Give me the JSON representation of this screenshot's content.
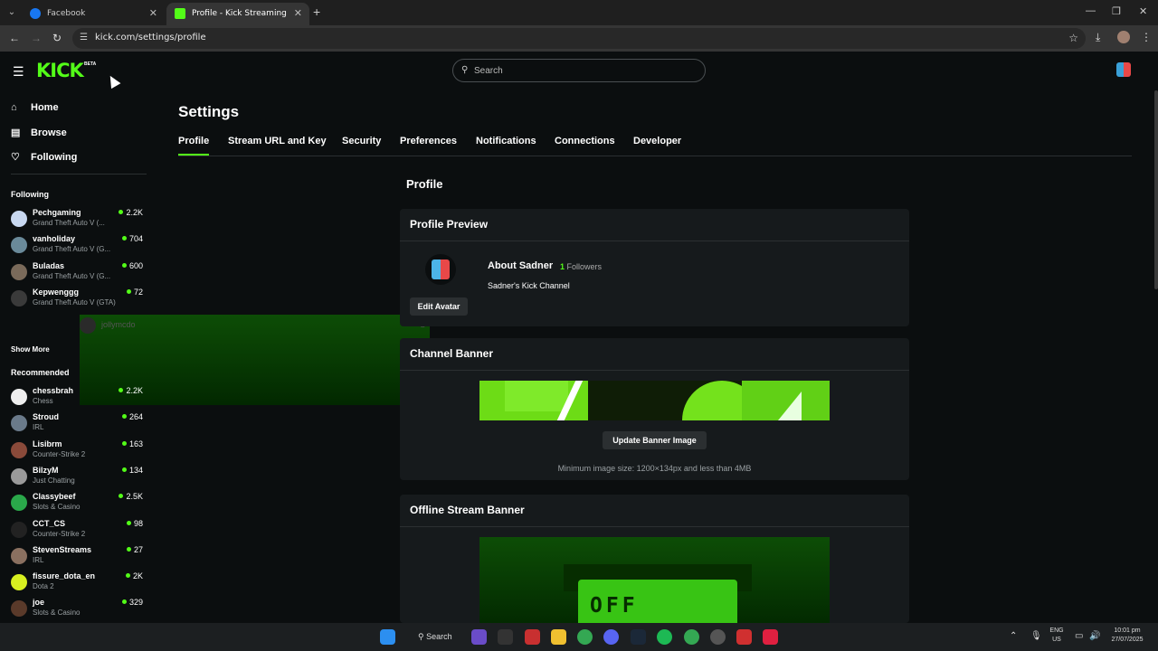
{
  "browser": {
    "tabs": [
      {
        "label": "Facebook"
      },
      {
        "label": "Profile - Kick Streaming"
      }
    ],
    "url": "kick.com/settings/profile"
  },
  "header": {
    "logo": "KICK",
    "beta": "BETA",
    "search_placeholder": "Search"
  },
  "sidebar": {
    "nav": [
      {
        "label": "Home",
        "icon": "home-icon",
        "glyph": "⌂"
      },
      {
        "label": "Browse",
        "icon": "browse-icon",
        "glyph": "▤"
      },
      {
        "label": "Following",
        "icon": "heart-icon",
        "glyph": "♡"
      }
    ],
    "following_header": "Following",
    "following": [
      {
        "name": "Pechgaming",
        "game": "Grand Theft Auto V (...",
        "viewers": "2.2K",
        "color": "#c8d8f0"
      },
      {
        "name": "vanholiday",
        "game": "Grand Theft Auto V (G...",
        "viewers": "704",
        "color": "#6a8a9a"
      },
      {
        "name": "Buladas",
        "game": "Grand Theft Auto V (G...",
        "viewers": "600",
        "color": "#7a6a5a"
      },
      {
        "name": "Kepwenggg",
        "game": "Grand Theft Auto V (GTA)",
        "viewers": "72",
        "color": "#3a3a3a"
      }
    ],
    "offline_channel": {
      "name": "jollymcdo",
      "icon": "offline-icon"
    },
    "show_more": "Show More",
    "recommended_header": "Recommended",
    "recommended": [
      {
        "name": "chessbrah",
        "game": "Chess",
        "viewers": "2.2K",
        "color": "#eeeeee"
      },
      {
        "name": "Stroud",
        "game": "IRL",
        "viewers": "264",
        "color": "#6a7a8a"
      },
      {
        "name": "Lisibrm",
        "game": "Counter-Strike 2",
        "viewers": "163",
        "color": "#8a4a3a"
      },
      {
        "name": "BilzyM",
        "game": "Just Chatting",
        "viewers": "134",
        "color": "#9a9a9a"
      },
      {
        "name": "Classybeef",
        "game": "Slots & Casino",
        "viewers": "2.5K",
        "color": "#2aa84a"
      },
      {
        "name": "CCT_CS",
        "game": "Counter-Strike 2",
        "viewers": "98",
        "color": "#222222"
      },
      {
        "name": "StevenStreams",
        "game": "IRL",
        "viewers": "27",
        "color": "#8a7060"
      },
      {
        "name": "fissure_dota_en",
        "game": "Dota 2",
        "viewers": "2K",
        "color": "#d8f020"
      },
      {
        "name": "joe",
        "game": "Slots & Casino",
        "viewers": "329",
        "color": "#5a3a2a"
      }
    ]
  },
  "main": {
    "title": "Settings",
    "tabs": [
      "Profile",
      "Stream URL and Key",
      "Security",
      "Preferences",
      "Notifications",
      "Connections",
      "Developer"
    ],
    "section_title": "Profile",
    "preview": {
      "heading": "Profile Preview",
      "about": "About Sadner",
      "followers_count": "1",
      "followers_label": "Followers",
      "bio": "Sadner's Kick Channel",
      "edit_avatar": "Edit Avatar"
    },
    "banner": {
      "heading": "Channel Banner",
      "button": "Update Banner Image",
      "hint": "Minimum image size: 1200×134px and less than 4MB"
    },
    "offline_banner": {
      "heading": "Offline Stream Banner",
      "image_text": "OFF"
    }
  },
  "taskbar": {
    "search": "Search",
    "lang": "ENG",
    "region": "US",
    "time": "10:01 pm",
    "date": "27/07/2025"
  },
  "colors": {
    "accent": "#53fc18",
    "background": "#0b0e0f",
    "card": "#161a1c"
  }
}
